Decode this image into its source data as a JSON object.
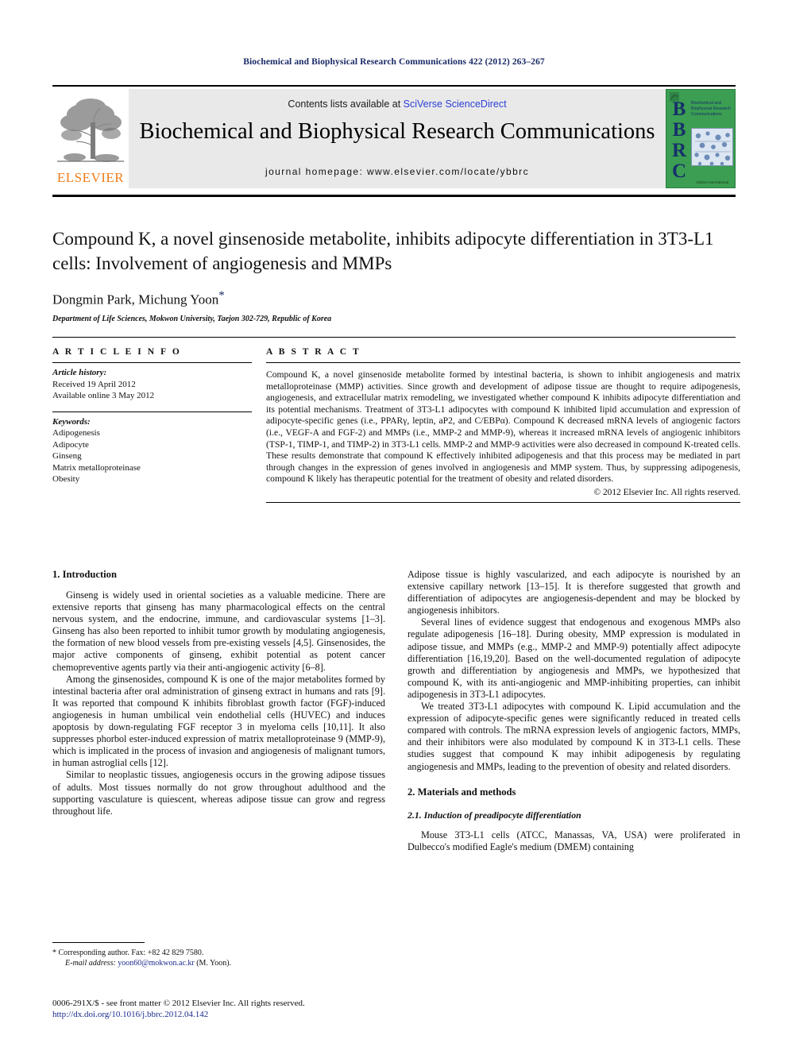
{
  "running_head": "Biochemical and Biophysical Research Communications 422 (2012) 263–267",
  "masthead": {
    "publisher_name": "ELSEVIER",
    "contents_prefix": "Contents lists available at ",
    "contents_link": "SciVerse ScienceDirect",
    "journal_title": "Biochemical and Biophysical Research Communications",
    "homepage": "journal homepage: www.elsevier.com/locate/ybbrc",
    "cover": {
      "letters": "BBRC",
      "title": "Biochemical and Biophysical Research Communications",
      "footer": "Editors International",
      "bg_color": "#3b9e52",
      "letter_color": "#16306b"
    }
  },
  "article": {
    "title": "Compound K, a novel ginsenoside metabolite, inhibits adipocyte differentiation in 3T3-L1 cells: Involvement of angiogenesis and MMPs",
    "authors": "Dongmin Park, Michung Yoon",
    "corresponding_marker": "*",
    "affiliation": "Department of Life Sciences, Mokwon University, Taejon 302-729, Republic of Korea"
  },
  "article_info": {
    "heading": "A R T I C L E   I N F O",
    "history_label": "Article history:",
    "history": [
      "Received 19 April 2012",
      "Available online 3 May 2012"
    ],
    "keywords_label": "Keywords:",
    "keywords": [
      "Adipogenesis",
      "Adipocyte",
      "Ginseng",
      "Matrix metalloproteinase",
      "Obesity"
    ]
  },
  "abstract": {
    "heading": "A B S T R A C T",
    "text": "Compound K, a novel ginsenoside metabolite formed by intestinal bacteria, is shown to inhibit angiogenesis and matrix metalloproteinase (MMP) activities. Since growth and development of adipose tissue are thought to require adipogenesis, angiogenesis, and extracellular matrix remodeling, we investigated whether compound K inhibits adipocyte differentiation and its potential mechanisms. Treatment of 3T3-L1 adipocytes with compound K inhibited lipid accumulation and expression of adipocyte-specific genes (i.e., PPARγ, leptin, aP2, and C/EBPα). Compound K decreased mRNA levels of angiogenic factors (i.e., VEGF-A and FGF-2) and MMPs (i.e., MMP-2 and MMP-9), whereas it increased mRNA levels of angiogenic inhibitors (TSP-1, TIMP-1, and TIMP-2) in 3T3-L1 cells. MMP-2 and MMP-9 activities were also decreased in compound K-treated cells. These results demonstrate that compound K effectively inhibited adipogenesis and that this process may be mediated in part through changes in the expression of genes involved in angiogenesis and MMP system. Thus, by suppressing adipogenesis, compound K likely has therapeutic potential for the treatment of obesity and related disorders.",
    "copyright": "© 2012 Elsevier Inc. All rights reserved."
  },
  "body": {
    "section1_heading": "1. Introduction",
    "left_paragraphs": [
      "Ginseng is widely used in oriental societies as a valuable medicine. There are extensive reports that ginseng has many pharmacological effects on the central nervous system, and the endocrine, immune, and cardiovascular systems [1–3]. Ginseng has also been reported to inhibit tumor growth by modulating angiogenesis, the formation of new blood vessels from pre-existing vessels [4,5]. Ginsenosides, the major active components of ginseng, exhibit potential as potent cancer chemopreventive agents partly via their anti-angiogenic activity [6–8].",
      "Among the ginsenosides, compound K is one of the major metabolites formed by intestinal bacteria after oral administration of ginseng extract in humans and rats [9]. It was reported that compound K inhibits fibroblast growth factor (FGF)-induced angiogenesis in human umbilical vein endothelial cells (HUVEC) and induces apoptosis by down-regulating FGF receptor 3 in myeloma cells [10,11]. It also suppresses phorbol ester-induced expression of matrix metalloproteinase 9 (MMP-9), which is implicated in the process of invasion and angiogenesis of malignant tumors, in human astroglial cells [12].",
      "Similar to neoplastic tissues, angiogenesis occurs in the growing adipose tissues of adults. Most tissues normally do not grow throughout adulthood and the supporting vasculature is quiescent, whereas adipose tissue can grow and regress throughout life."
    ],
    "right_paragraphs": [
      "Adipose tissue is highly vascularized, and each adipocyte is nourished by an extensive capillary network [13–15]. It is therefore suggested that growth and differentiation of adipocytes are angiogenesis-dependent and may be blocked by angiogenesis inhibitors.",
      "Several lines of evidence suggest that endogenous and exogenous MMPs also regulate adipogenesis [16–18]. During obesity, MMP expression is modulated in adipose tissue, and MMPs (e.g., MMP-2 and MMP-9) potentially affect adipocyte differentiation [16,19,20]. Based on the well-documented regulation of adipocyte growth and differentiation by angiogenesis and MMPs, we hypothesized that compound K, with its anti-angiogenic and MMP-inhibiting properties, can inhibit adipogenesis in 3T3-L1 adipocytes.",
      "We treated 3T3-L1 adipocytes with compound K. Lipid accumulation and the expression of adipocyte-specific genes were significantly reduced in treated cells compared with controls. The mRNA expression levels of angiogenic factors, MMPs, and their inhibitors were also modulated by compound K in 3T3-L1 cells. These studies suggest that compound K may inhibit adipogenesis by regulating angiogenesis and MMPs, leading to the prevention of obesity and related disorders."
    ],
    "section2_heading": "2. Materials and methods",
    "subsection21_heading": "2.1. Induction of preadipocyte differentiation",
    "subsection21_paragraph": "Mouse 3T3-L1 cells (ATCC, Manassas, VA, USA) were proliferated in Dulbecco's modified Eagle's medium (DMEM) containing"
  },
  "footnote": {
    "marker": "*",
    "corresponding": "Corresponding author. Fax: +82 42 829 7580.",
    "email_label": "E-mail address:",
    "email": "yoon60@mokwon.ac.kr",
    "email_suffix": "(M. Yoon)."
  },
  "page_footer": {
    "issn_line": "0006-291X/$ - see front matter © 2012 Elsevier Inc. All rights reserved.",
    "doi": "http://dx.doi.org/10.1016/j.bbrc.2012.04.142"
  }
}
